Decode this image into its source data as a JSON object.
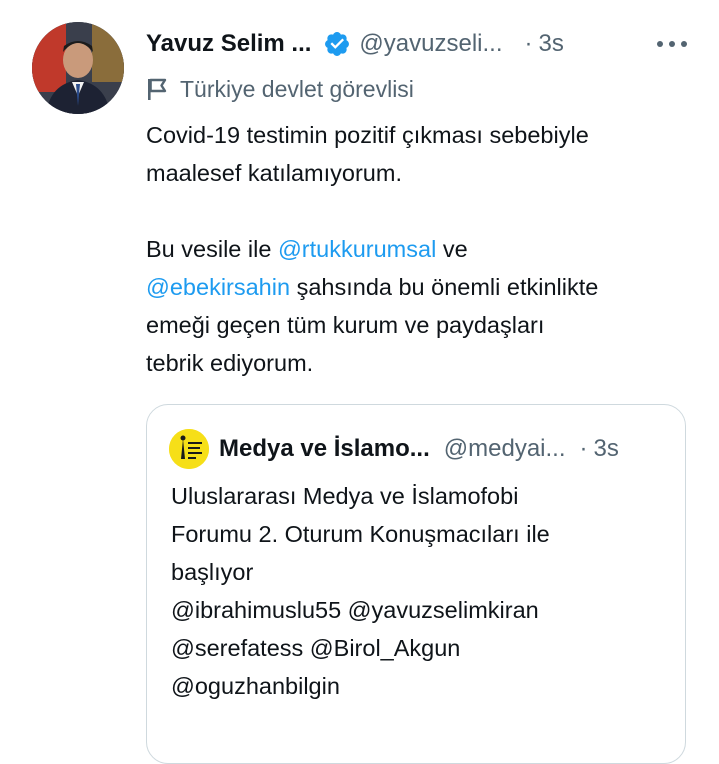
{
  "tweet": {
    "author_name": "Yavuz Selim ...",
    "author_handle": "@yavuzseli...",
    "separator": "·",
    "time": "3s",
    "label": "Türkiye devlet görevlisi",
    "text_line1": "Covid-19 testimin pozitif çıkması sebebiyle",
    "text_line2": "maalesef katılamıyorum.",
    "text_line3_a": "Bu vesile ile ",
    "mention1": "@rtukkurumsal",
    "text_line3_b": " ve",
    "mention2": "@ebekirsahin",
    "text_line4_b": " şahsında bu önemli etkinlikte",
    "text_line5": "emeği geçen tüm kurum ve paydaşları",
    "text_line6": "tebrik ediyorum."
  },
  "quote": {
    "author_name": "Medya ve İslamo...",
    "author_handle": "@medyai...",
    "separator": "·",
    "time": "3s",
    "line1": "Uluslararası Medya ve İslamofobi",
    "line2": "Forumu 2. Oturum Konuşmacıları ile",
    "line3": "başlıyor",
    "line4": "@ibrahimuslu55 @yavuzselimkiran",
    "line5": "@serefatess @Birol_Akgun",
    "line6": "@oguzhanbilgin"
  },
  "colors": {
    "accent": "#1d9bf0",
    "text": "#0f1419",
    "secondary": "#536471",
    "border": "#cfd9de",
    "quote_avatar": "#f6df18"
  },
  "icons": [
    "verified-badge-icon",
    "more-options-icon",
    "flag-icon"
  ]
}
